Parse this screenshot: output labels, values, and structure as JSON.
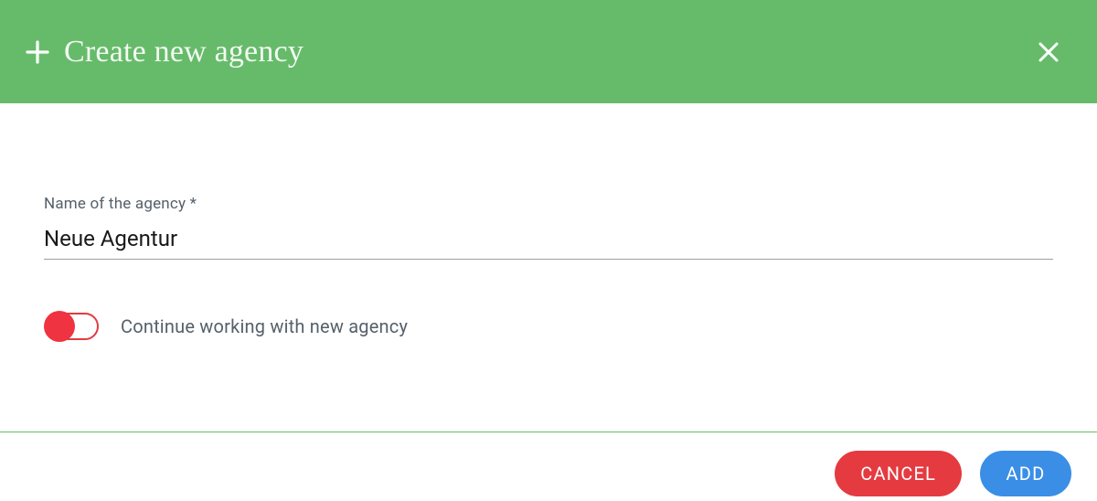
{
  "colors": {
    "header_bg": "#66BB6A",
    "cancel_btn": "#e53a40",
    "add_btn": "#3a8ee6",
    "toggle_thumb": "#ef3340",
    "label_text": "#55606b"
  },
  "header": {
    "icon": "plus-icon",
    "title": "Create new agency",
    "close_icon": "close-icon"
  },
  "form": {
    "name_label": "Name of the agency *",
    "name_value": "Neue Agentur",
    "toggle_state": "off",
    "toggle_label": "Continue working with new agency"
  },
  "footer": {
    "cancel_label": "CANCEL",
    "add_label": "ADD"
  }
}
